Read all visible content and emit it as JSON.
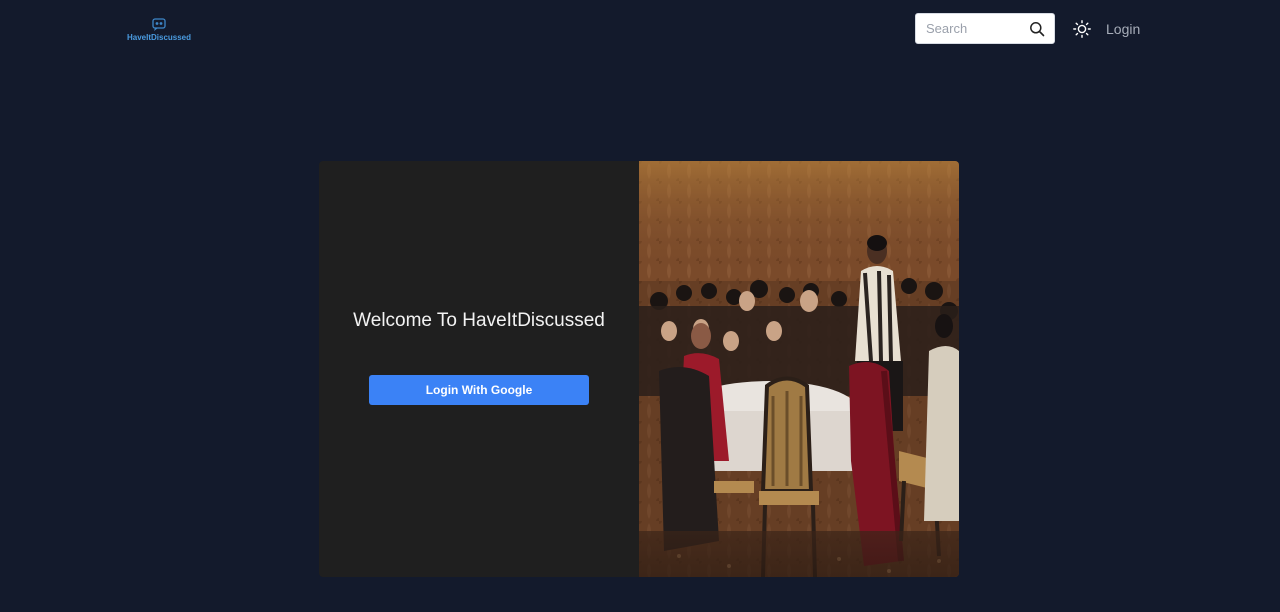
{
  "header": {
    "logo_text": "HaveItDiscussed",
    "search": {
      "placeholder": "Search",
      "value": ""
    },
    "theme_toggle_icon": "sun-icon",
    "login_label": "Login"
  },
  "card": {
    "welcome_text": "Welcome To HaveItDiscussed",
    "google_button_label": "Login With Google",
    "image_description_icon": "conference-photo"
  },
  "colors": {
    "background": "#131a2c",
    "card_left": "#1f1f1f",
    "primary_button": "#3b82f6",
    "logo_text": "#4a9be0"
  }
}
